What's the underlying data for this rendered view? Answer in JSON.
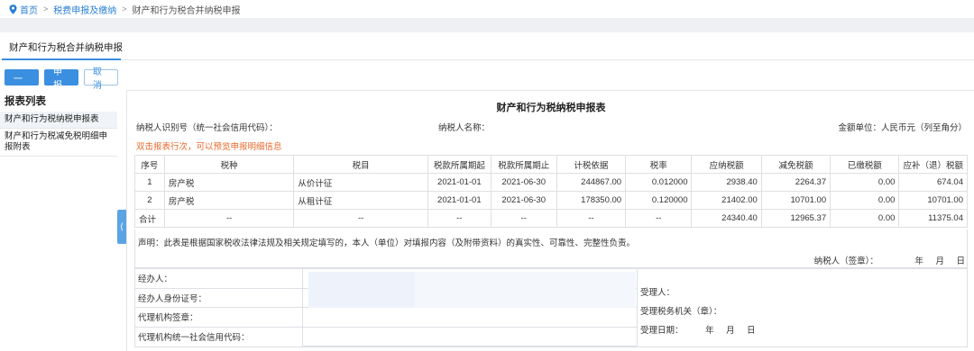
{
  "breadcrumb": {
    "home": "首页",
    "level2": "税费申报及缴纳",
    "current": "财产和行为税合并纳税申报"
  },
  "page_title": "财产和行为税合并纳税申报",
  "toolbar": {
    "prev_label": "上一步",
    "submit_label": "申报",
    "cancel_label": "取消"
  },
  "sidebar": {
    "title": "报表列表",
    "items": [
      {
        "label": "财产和行为税纳税申报表"
      },
      {
        "label": "财产和行为税减免税明细申报附表"
      }
    ]
  },
  "form": {
    "title": "财产和行为税纳税申报表",
    "taxpayer_id_label": "纳税人识别号（统一社会信用代码）：",
    "taxpayer_name_label": "纳税人名称：",
    "unit_label": "金额单位：人民币元（列至角分）",
    "hint": "双击报表行次，可以预览申报明细信息",
    "columns": [
      "序号",
      "税种",
      "税目",
      "税款所属期起",
      "税款所属期止",
      "计税依据",
      "税率",
      "应纳税额",
      "减免税额",
      "已缴税额",
      "应补（退）税额"
    ],
    "rows": [
      {
        "no": "1",
        "tax_type": "房产税",
        "item": "从价计征",
        "start": "2021-01-01",
        "end": "2021-06-30",
        "basis": "244867.00",
        "rate": "0.012000",
        "payable": "2938.40",
        "relief": "2264.37",
        "paid": "0.00",
        "due": "674.04"
      },
      {
        "no": "2",
        "tax_type": "房产税",
        "item": "从租计征",
        "start": "2021-01-01",
        "end": "2021-06-30",
        "basis": "178350.00",
        "rate": "0.120000",
        "payable": "21402.00",
        "relief": "10701.00",
        "paid": "0.00",
        "due": "10701.00"
      }
    ],
    "total": {
      "no": "合计",
      "tax_type": "--",
      "item": "--",
      "start": "--",
      "end": "--",
      "basis": "--",
      "rate": "--",
      "payable": "24340.40",
      "relief": "12965.37",
      "paid": "0.00",
      "due": "11375.04"
    },
    "declaration": "声明：此表是根据国家税收法律法规及相关规定填写的，本人（单位）对填报内容（及附带资料）的真实性、可靠性、完整性负责。",
    "taxpayer_sign": "纳税人（签章）：",
    "date_ymd": "年　月　日",
    "agent_label": "经办人：",
    "agent_id_label": "经办人身份证号：",
    "agency_seal_label": "代理机构签章：",
    "agency_code_label": "代理机构统一社会信用代码：",
    "receiver_label": "受理人：",
    "tax_office_label": "受理税务机关（章）：",
    "receive_date_label": "受理日期：",
    "receive_date_ymd": "年　月　日"
  },
  "colors": {
    "accent": "#3b8fe0",
    "hint": "#e66a2c"
  }
}
